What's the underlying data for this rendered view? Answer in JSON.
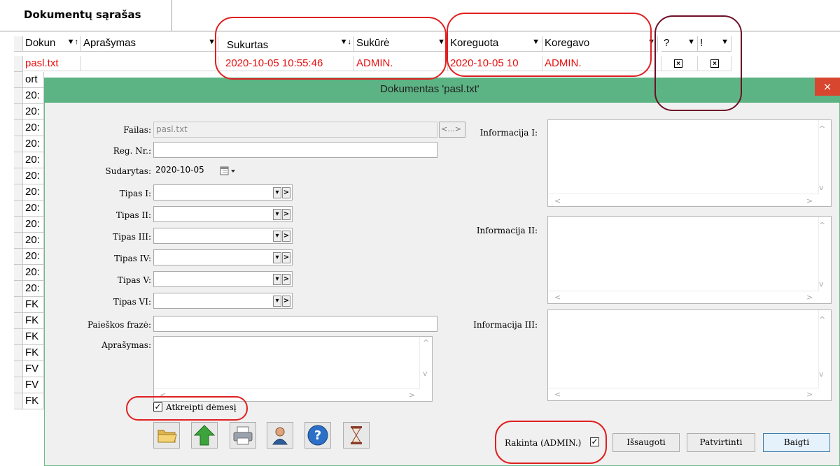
{
  "tab": {
    "title": "Dokumentų sąrašas"
  },
  "grid": {
    "headers": [
      {
        "label": "Dokun",
        "arrow": "▼↑"
      },
      {
        "label": "Aprašymas",
        "arrow": "▼"
      },
      {
        "label": "Sukurtas",
        "arrow": "▼↓"
      },
      {
        "label": "Sukūrė",
        "arrow": "▼"
      },
      {
        "label": "Koreguota",
        "arrow": "▼"
      },
      {
        "label": "Koregavo",
        "arrow": "▼"
      },
      {
        "label": "?",
        "arrow": "▼"
      },
      {
        "label": "!",
        "arrow": "▼"
      }
    ],
    "selected_row": {
      "doc": "pasl.txt",
      "created": "2020-10-05 10:55:46",
      "creator": "ADMIN.",
      "modified": "2020-10-05 10",
      "modifier": "ADMIN.",
      "q": "×",
      "excl": "×"
    },
    "left_rows": [
      "ort",
      "20:",
      "20:",
      "20:",
      "20:",
      "20:",
      "20:",
      "20:",
      "20:",
      "20:",
      "20:",
      "20:",
      "20:",
      "20:",
      "FK",
      "FK",
      "FK",
      "FK",
      "FV",
      "FV",
      "FK"
    ]
  },
  "dialog": {
    "title": "Dokumentas 'pasl.txt'",
    "close": "×",
    "labels": {
      "failas": "Failas:",
      "reg": "Reg. Nr.:",
      "sudarytas": "Sudarytas:",
      "tipas1": "Tipas I:",
      "tipas2": "Tipas II:",
      "tipas3": "Tipas III:",
      "tipas4": "Tipas IV:",
      "tipas5": "Tipas V:",
      "tipas6": "Tipas VI:",
      "paieskos": "Paieškos frazė:",
      "aprasymas": "Aprašymas:",
      "info1": "Informacija I:",
      "info2": "Informacija II:",
      "info3": "Informacija III:"
    },
    "values": {
      "failas": "pasl.txt",
      "browse": "<...>",
      "sudarytas": "2020-10-05"
    },
    "attention": "Atkreipti dėmesį",
    "rakinta": "Rakinta (ADMIN.)",
    "buttons": {
      "save": "Išsaugoti",
      "confirm": "Patvirtinti",
      "finish": "Baigti"
    },
    "colors": {
      "title_bar": "#5cb383",
      "close": "#d9462f",
      "annotation": "#e02020"
    }
  }
}
